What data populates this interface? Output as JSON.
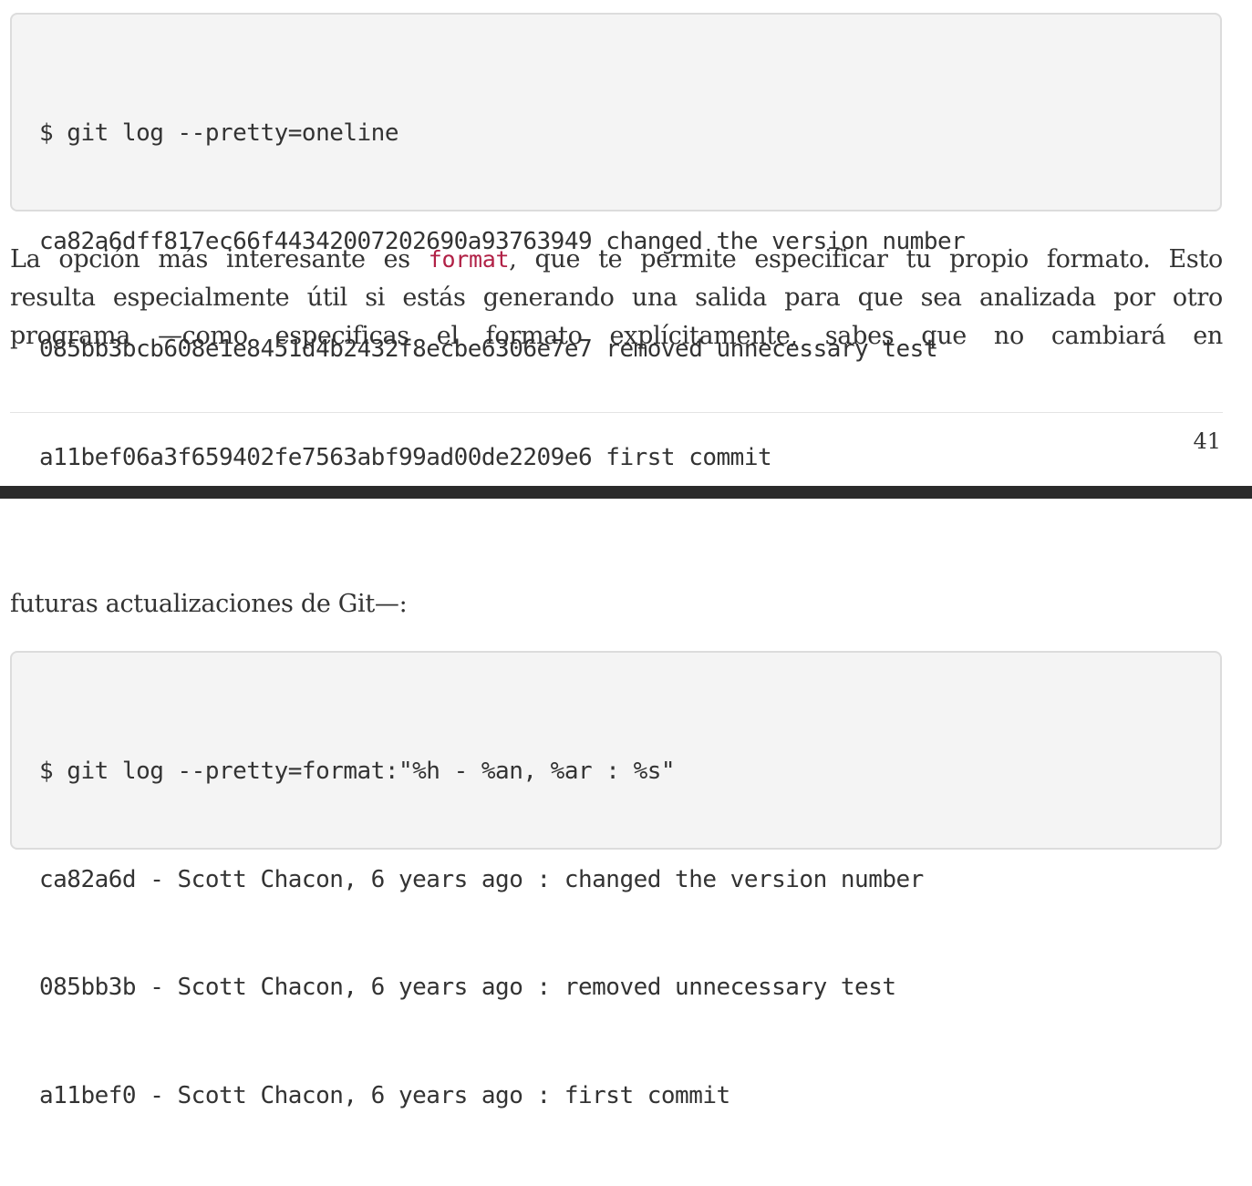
{
  "top_code_block": {
    "lines": [
      "$ git log --pretty=oneline",
      "ca82a6dff817ec66f44342007202690a93763949 changed the version number",
      "085bb3bcb608e1e8451d4b2432f8ecbe6306e7e7 removed unnecessary test",
      "a11bef06a3f659402fe7563abf99ad00de2209e6 first commit"
    ]
  },
  "paragraph_1": {
    "line_1_before": "La opción más interesante es ",
    "line_1_code": "format",
    "line_1_after": ", que te permite especificar tu propio formato. Esto",
    "line_2": "resulta especialmente útil si estás generando una salida para que sea analizada por otro",
    "line_3": "programa —como especificas el formato explícitamente, sabes que no cambiará en"
  },
  "page_number": "41",
  "paragraph_2": "futuras actualizaciones de Git—:",
  "bottom_code_block": {
    "lines": [
      "$ git log --pretty=format:\"%h - %an, %ar : %s\"",
      "ca82a6d - Scott Chacon, 6 years ago : changed the version number",
      "085bb3b - Scott Chacon, 6 years ago : removed unnecessary test",
      "a11bef0 - Scott Chacon, 6 years ago : first commit"
    ]
  }
}
